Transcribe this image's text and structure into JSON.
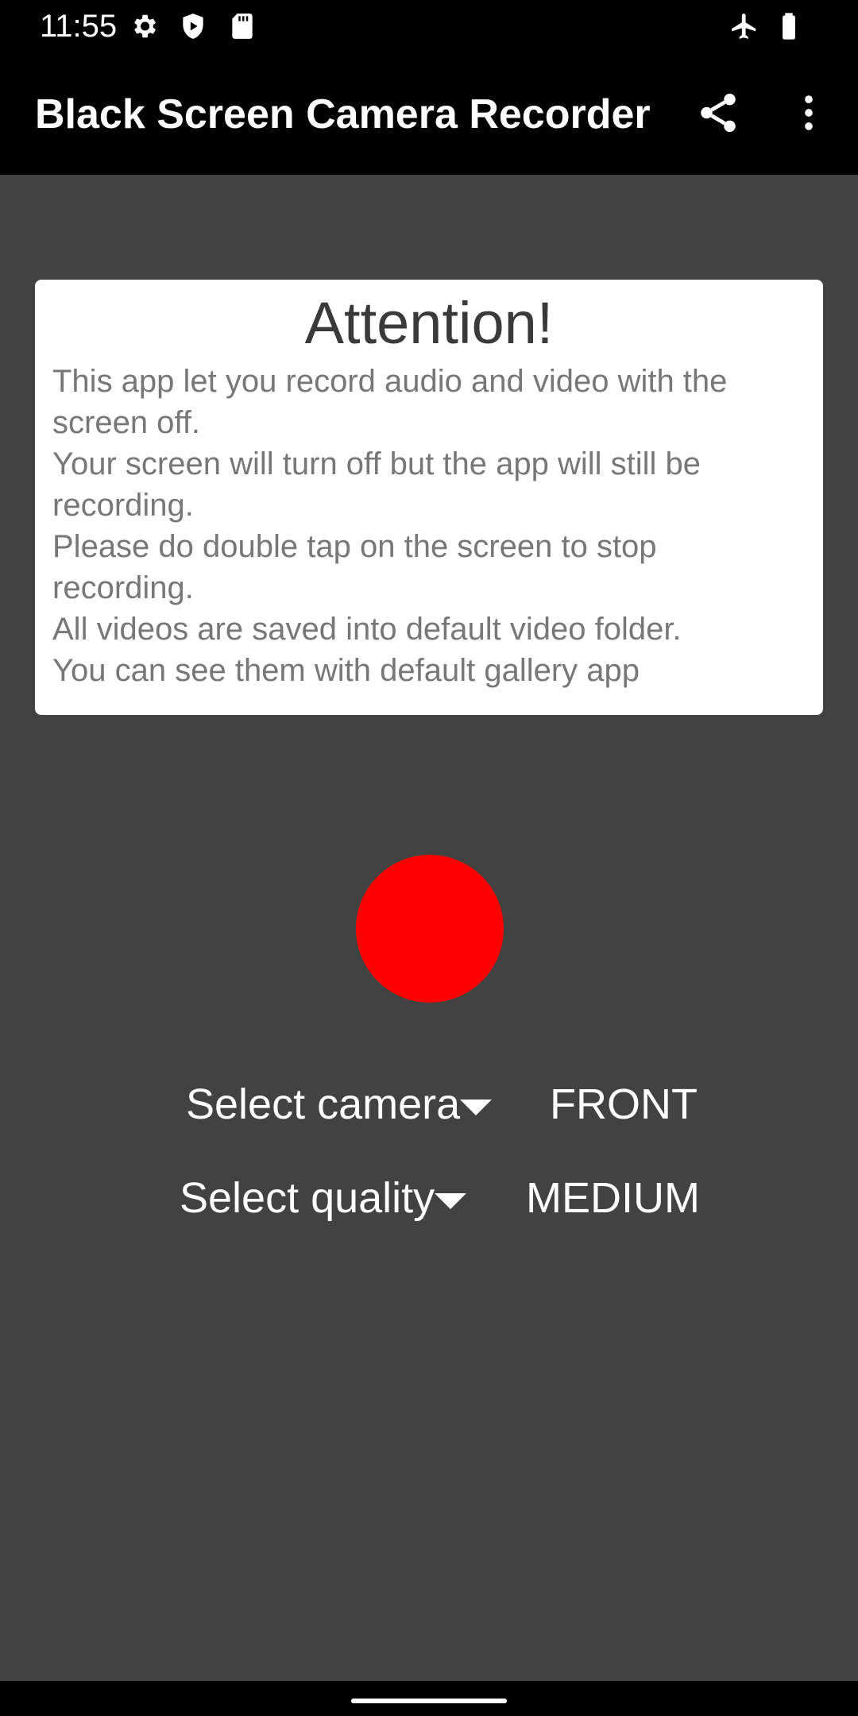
{
  "status_bar": {
    "time": "11:55",
    "icons_left": [
      "gear-icon",
      "shield-play-icon",
      "sd-card-icon"
    ],
    "icons_right": [
      "airplane-icon",
      "battery-icon"
    ]
  },
  "app_bar": {
    "title": "Black Screen Camera Recorder",
    "actions": [
      "share-icon",
      "more-vert-icon"
    ]
  },
  "card": {
    "title": "Attention!",
    "lines": [
      "This app let you record audio and video with the",
      "screen off.",
      "Your screen will turn off but the app will still be",
      "recording.",
      "Please do double tap on the screen to stop",
      "recording.",
      "All videos are saved into default video folder.",
      "You can see them with default gallery app"
    ]
  },
  "record_button": {
    "color": "#ff0000"
  },
  "selectors": {
    "camera": {
      "label": "Select camera",
      "value": "FRONT"
    },
    "quality": {
      "label": "Select quality",
      "value": "MEDIUM"
    }
  },
  "colors": {
    "background": "#424242",
    "bar": "#000000",
    "card": "#ffffff",
    "record": "#ff0000"
  }
}
